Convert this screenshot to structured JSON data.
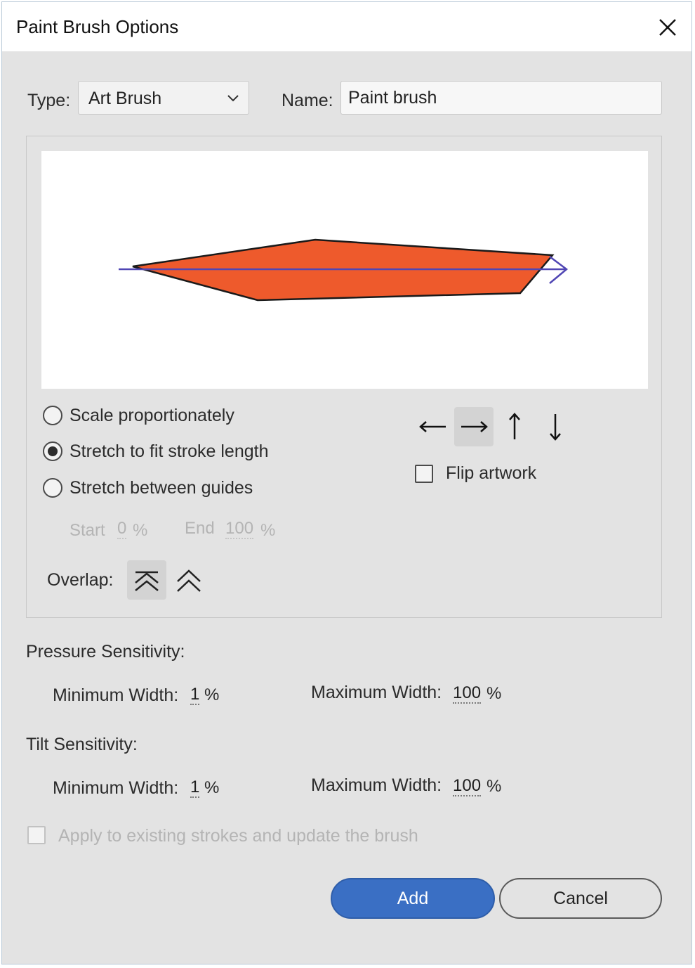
{
  "dialog": {
    "title": "Paint Brush Options"
  },
  "type": {
    "label": "Type:",
    "value": "Art Brush"
  },
  "name": {
    "label": "Name:",
    "value": "Paint brush"
  },
  "preview": {
    "brush_fill": "#EE5A2C",
    "guide_color": "#5046B4",
    "outline_color": "#1A1A1A"
  },
  "scale_options": [
    {
      "label": "Scale proportionately",
      "selected": false
    },
    {
      "label": "Stretch to fit stroke length",
      "selected": true
    },
    {
      "label": "Stretch between guides",
      "selected": false
    }
  ],
  "guides": {
    "start_label": "Start",
    "start_value": "0",
    "start_unit": "%",
    "end_label": "End",
    "end_value": "100",
    "end_unit": "%"
  },
  "overlap": {
    "label": "Overlap:"
  },
  "directions": [
    {
      "icon": "arrow-left-icon",
      "symbol": "←",
      "selected": false
    },
    {
      "icon": "arrow-right-icon",
      "symbol": "→",
      "selected": true
    },
    {
      "icon": "arrow-up-icon",
      "symbol": "↑",
      "selected": false
    },
    {
      "icon": "arrow-down-icon",
      "symbol": "↓",
      "selected": false
    }
  ],
  "flip": {
    "label": "Flip artwork",
    "checked": false
  },
  "pressure": {
    "heading": "Pressure Sensitivity:",
    "min_label": "Minimum Width:",
    "min_value": "1",
    "min_unit": "%",
    "max_label": "Maximum Width:",
    "max_value": "100",
    "max_unit": "%"
  },
  "tilt": {
    "heading": "Tilt Sensitivity:",
    "min_label": "Minimum Width:",
    "min_value": "1",
    "min_unit": "%",
    "max_label": "Maximum Width:",
    "max_value": "100",
    "max_unit": "%"
  },
  "apply": {
    "label": "Apply to existing strokes and update the brush",
    "checked": false,
    "enabled": false
  },
  "buttons": {
    "add": "Add",
    "cancel": "Cancel"
  },
  "colors": {
    "accent": "#3A6FC4",
    "dialog_bg": "#E3E3E3"
  }
}
